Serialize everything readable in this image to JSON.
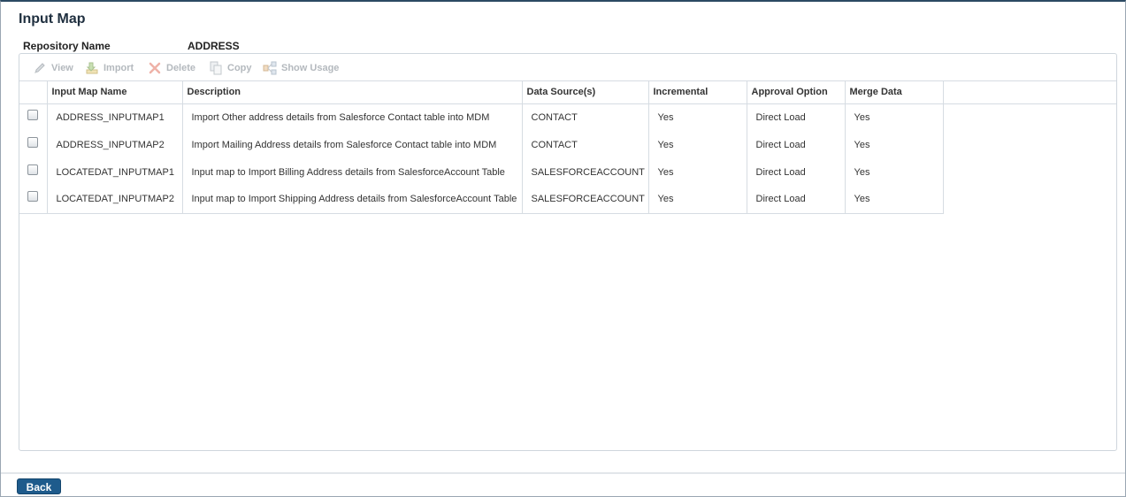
{
  "page": {
    "title": "Input Map"
  },
  "repository": {
    "label": "Repository Name",
    "value": "ADDRESS"
  },
  "toolbar": {
    "view_label": "View",
    "import_label": "Import",
    "delete_label": "Delete",
    "copy_label": "Copy",
    "show_usage_label": "Show Usage",
    "disabled_color": "#b4b9be"
  },
  "table": {
    "columns": [
      "Input Map Name",
      "Description",
      "Data Source(s)",
      "Incremental",
      "Approval Option",
      "Merge Data"
    ],
    "rows": [
      [
        "ADDRESS_INPUTMAP1",
        "Import Other address details from Salesforce Contact table into MDM",
        "CONTACT",
        "Yes",
        "Direct Load",
        "Yes"
      ],
      [
        "ADDRESS_INPUTMAP2",
        "Import Mailing Address details from Salesforce Contact table into MDM",
        "CONTACT",
        "Yes",
        "Direct Load",
        "Yes"
      ],
      [
        "LOCATEDAT_INPUTMAP1",
        "Input map to Import Billing Address details from SalesforceAccount Table",
        "SALESFORCEACCOUNT",
        "Yes",
        "Direct Load",
        "Yes"
      ],
      [
        "LOCATEDAT_INPUTMAP2",
        "Input map to Import Shipping Address details from SalesforceAccount Table",
        "SALESFORCEACCOUNT",
        "Yes",
        "Direct Load",
        "Yes"
      ]
    ]
  },
  "footer": {
    "back_label": "Back",
    "accent_color": "#1e5b8c"
  }
}
